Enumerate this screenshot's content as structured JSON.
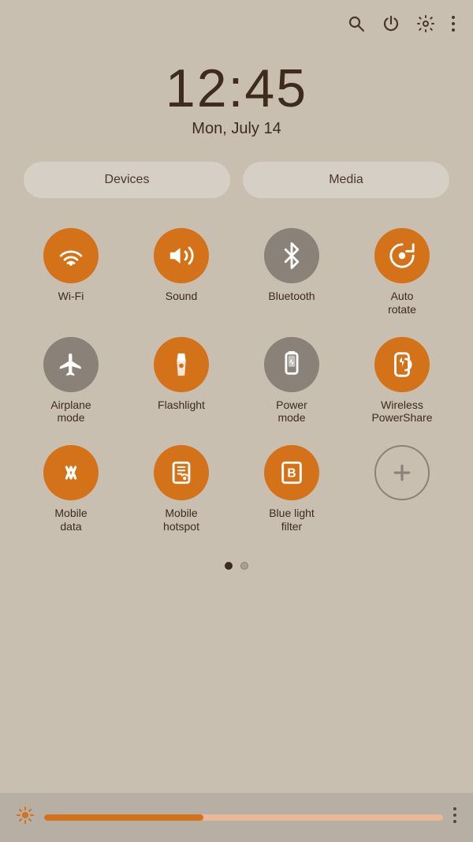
{
  "topbar": {
    "icons": [
      "search",
      "power",
      "settings",
      "more"
    ]
  },
  "clock": {
    "time": "12:45",
    "date": "Mon, July 14"
  },
  "buttons": {
    "devices": "Devices",
    "media": "Media"
  },
  "grid": [
    {
      "id": "wifi",
      "label": "Wi-Fi",
      "state": "active"
    },
    {
      "id": "sound",
      "label": "Sound",
      "state": "active"
    },
    {
      "id": "bluetooth",
      "label": "Bluetooth",
      "state": "inactive"
    },
    {
      "id": "autorotate",
      "label": "Auto\nrotate",
      "state": "active"
    },
    {
      "id": "airplanemode",
      "label": "Airplane\nmode",
      "state": "inactive"
    },
    {
      "id": "flashlight",
      "label": "Flashlight",
      "state": "active"
    },
    {
      "id": "powermode",
      "label": "Power\nmode",
      "state": "inactive"
    },
    {
      "id": "wirelesspowershare",
      "label": "Wireless\nPowerShare",
      "state": "active"
    },
    {
      "id": "mobiledata",
      "label": "Mobile\ndata",
      "state": "active"
    },
    {
      "id": "mobilehotspot",
      "label": "Mobile\nhotspot",
      "state": "active"
    },
    {
      "id": "bluelightfilter",
      "label": "Blue light\nfilter",
      "state": "active"
    },
    {
      "id": "add",
      "label": "",
      "state": "add"
    }
  ],
  "dots": [
    {
      "active": true
    },
    {
      "active": false
    }
  ],
  "brightness": {
    "value": 40
  }
}
